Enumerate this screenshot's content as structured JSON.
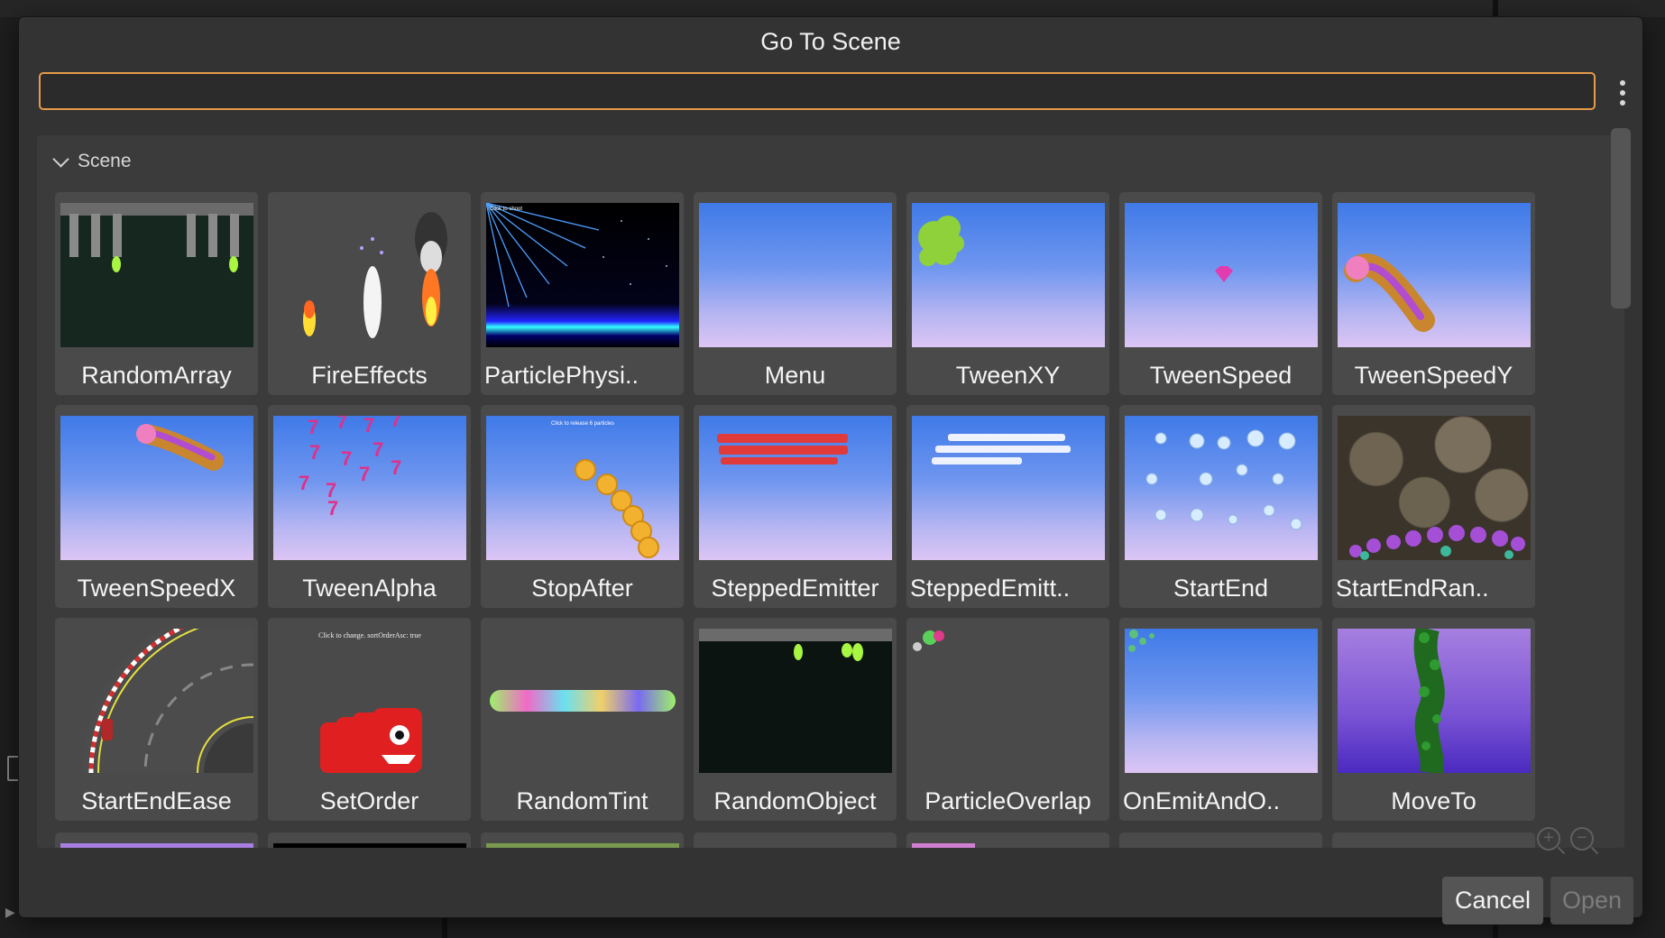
{
  "dialog": {
    "title": "Go To Scene",
    "search": {
      "value": "",
      "placeholder": ""
    },
    "group_label": "Scene",
    "cancel_label": "Cancel",
    "open_label": "Open",
    "zoom_in_glyph": "+",
    "zoom_out_glyph": "−"
  },
  "scenes": [
    {
      "label": "RandomArray",
      "thumb": "dark"
    },
    {
      "label": "FireEffects",
      "thumb": "blank"
    },
    {
      "label": "ParticlePhysi..",
      "thumb": "space",
      "caption": "Click to shoot"
    },
    {
      "label": "Menu",
      "thumb": "sky"
    },
    {
      "label": "TweenXY",
      "thumb": "sky"
    },
    {
      "label": "TweenSpeed",
      "thumb": "sky"
    },
    {
      "label": "TweenSpeedY",
      "thumb": "sky"
    },
    {
      "label": "TweenSpeedX",
      "thumb": "sky"
    },
    {
      "label": "TweenAlpha",
      "thumb": "sky"
    },
    {
      "label": "StopAfter",
      "thumb": "sky",
      "caption": "Click to release 6 particles"
    },
    {
      "label": "SteppedEmitter",
      "thumb": "sky"
    },
    {
      "label": "SteppedEmitt..",
      "thumb": "sky"
    },
    {
      "label": "StartEnd",
      "thumb": "sky"
    },
    {
      "label": "StartEndRan..",
      "thumb": "rock"
    },
    {
      "label": "StartEndEase",
      "thumb": "road"
    },
    {
      "label": "SetOrder",
      "thumb": "blank",
      "caption": "Click to change. sortOrderAsc: true"
    },
    {
      "label": "RandomTint",
      "thumb": "blank"
    },
    {
      "label": "RandomObject",
      "thumb": "dark"
    },
    {
      "label": "ParticleOverlap",
      "thumb": "blank"
    },
    {
      "label": "OnEmitAndO..",
      "thumb": "sky"
    },
    {
      "label": "MoveTo",
      "thumb": "purple"
    }
  ],
  "colors": {
    "accent": "#e69a4a",
    "dialog_bg": "#333333",
    "card_bg": "#4a4a4a"
  }
}
